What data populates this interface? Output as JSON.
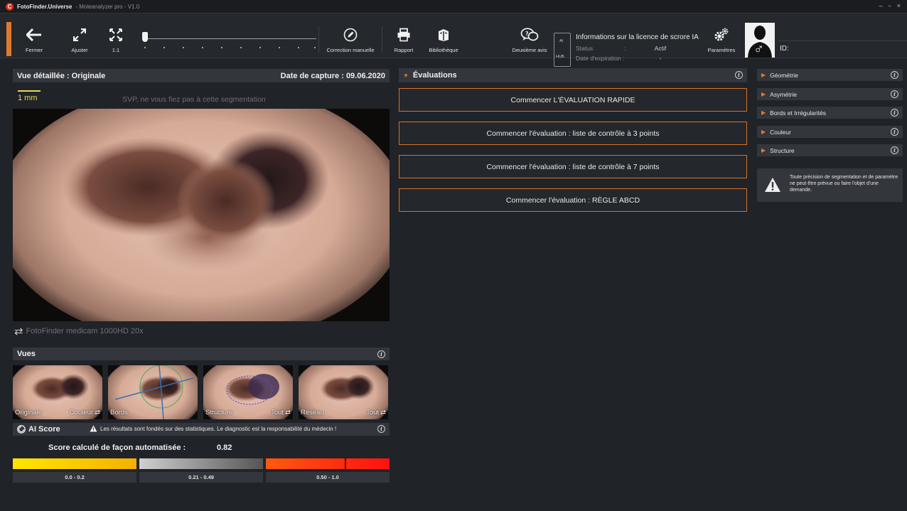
{
  "window": {
    "app_name": "FotoFinder.Universe",
    "subtitle": "- Moleanalyzer pro - V1.0",
    "controls": "– ▫ ×",
    "logo_letter": "C"
  },
  "toolbar": {
    "close": "Fermer",
    "fit": "Ajuster",
    "one_to_one": "1:1",
    "manual_correction": "Correction manuelle",
    "report": "Rapport",
    "library": "Bibliothèque",
    "second_opinion": "Deuxième avis",
    "settings": "Paramètres",
    "zoom_level": 0.0
  },
  "license": {
    "title": "Informations sur la licence de scrore IA",
    "ai_tag": "AI",
    "hub_tag": "HUB",
    "status_label": "Status",
    "status_sep": ":",
    "status_value": "Actif",
    "expiry_label": "Date d'expiration :",
    "expiry_value": "-"
  },
  "patient": {
    "gender_symbol": "♂",
    "id_label": "ID:"
  },
  "detail_view": {
    "title": "Vue détaillée : Originale",
    "capture_date": "Date de capture : 09.06.2020",
    "scale_label": "1 mm",
    "segmentation_warning": "SVP, ne vous fiez pas à cette segmentation",
    "camera": "FotoFinder medicam 1000HD 20x"
  },
  "views": {
    "title": "Vues",
    "thumbs": [
      {
        "left": "Originale",
        "right": "Couleur"
      },
      {
        "left": "Bords",
        "right": ""
      },
      {
        "left": "Structure",
        "right": "Tout"
      },
      {
        "left": "Réseau",
        "right": "Tout"
      }
    ]
  },
  "ai_score": {
    "title": "AI Score",
    "warning": "Les résultats sont fondés sur des statistiques. Le diagnostic est la responsabilité du médecin !",
    "score_label": "Score calculé de façon automatisée :",
    "score_value": "0.82",
    "score": 0.82,
    "ranges": [
      "0.0 - 0.2",
      "0.21 - 0.49",
      "0.50 - 1.0"
    ]
  },
  "evaluations": {
    "title": "Évaluations",
    "buttons": [
      "Commencer L'ÉVALUATION RAPIDE",
      "Commencer l'évaluation : liste de contrôle à 3 points",
      "Commencer l'évaluation : liste de contrôle à 7 points",
      "Commencer l'évaluation : RÈGLE ABCD"
    ]
  },
  "parameters": {
    "items": [
      "Géométrie",
      "Asymétrie",
      "Bords et Irrégularités",
      "Couleur",
      "Structure"
    ],
    "note": "Toute précision de segmentation et de paramètre ne peut être prévue ou faire l'objet d'une demande."
  },
  "colors": {
    "accent": "#e07a2b",
    "low": "#f5c000",
    "mid": "#8c8c8c",
    "high": "#ff3a10"
  },
  "icons": {
    "info": "i",
    "triangle": "▶",
    "warning": "!"
  }
}
